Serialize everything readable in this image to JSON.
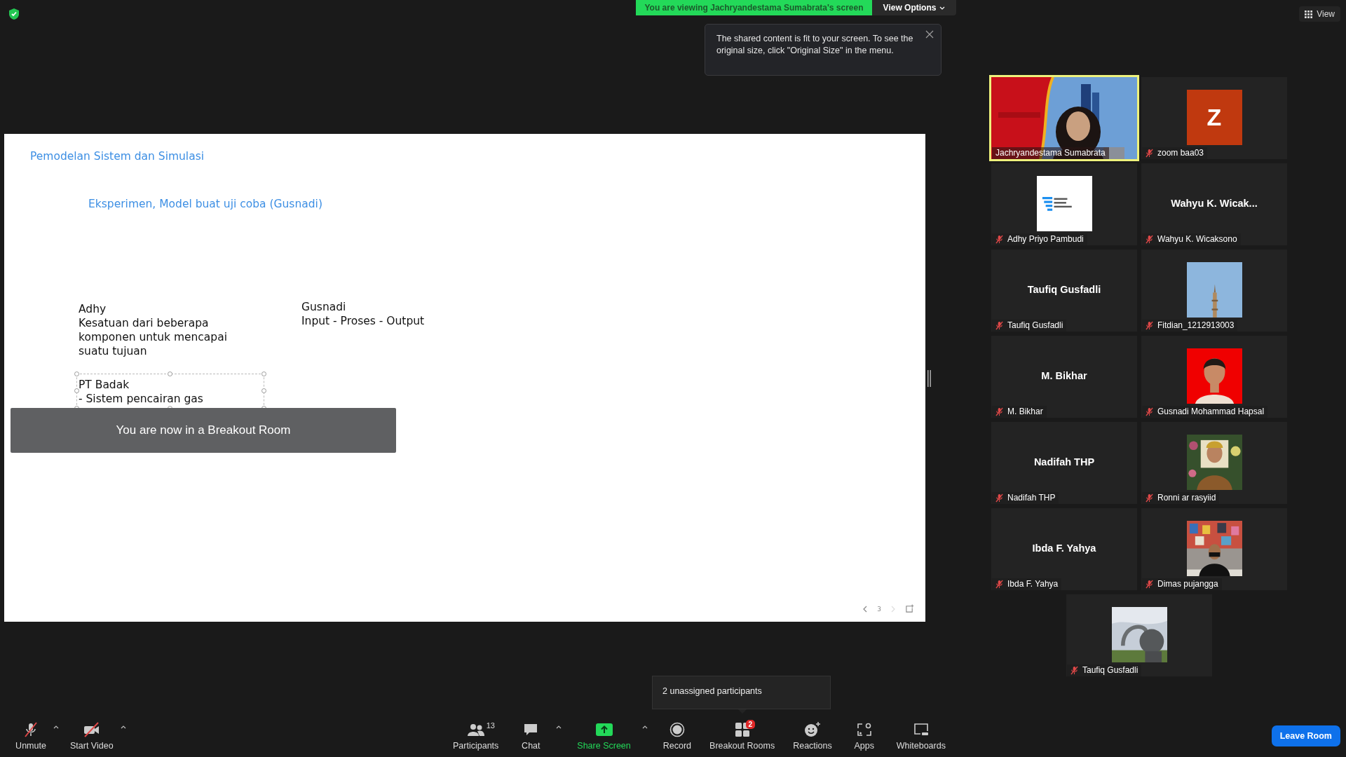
{
  "share_banner": {
    "text": "You are viewing Jachryandestama Sumabrata's screen",
    "view_options": "View Options"
  },
  "tooltip": {
    "text": "The shared content is fit to your screen. To see the original size, click \"Original Size\" in the menu."
  },
  "view_button": "View",
  "slide": {
    "title": "Pemodelan Sistem dan Simulasi",
    "subtitle": "Eksperimen, Model buat uji coba (Gusnadi)",
    "text_boxes": [
      {
        "lines": [
          "Adhy",
          "Kesatuan dari beberapa",
          "komponen untuk mencapai",
          "suatu tujuan"
        ],
        "selected": false
      },
      {
        "lines": [
          "Gusnadi",
          "Input - Proses - Output"
        ],
        "selected": false
      },
      {
        "lines": [
          "PT Badak",
          "- Sistem pencairan gas"
        ],
        "selected": true
      }
    ],
    "page": "3"
  },
  "breakout_notice": "You are now in a Breakout Room",
  "gallery": [
    {
      "name": "Jachryandestama Sumabrata",
      "kind": "video",
      "muted": false,
      "active_speaker": true
    },
    {
      "name": "zoom baa03",
      "kind": "initial",
      "initial": "Z",
      "muted": true,
      "active_speaker": false
    },
    {
      "name": "Adhy Priyo Pambudi",
      "kind": "picture",
      "muted": true,
      "active_speaker": false
    },
    {
      "name": "Wahyu K. Wicaksono",
      "kind": "name",
      "display_name": "Wahyu K. Wicak...",
      "muted": true,
      "active_speaker": false
    },
    {
      "name": "Taufiq Gusfadli",
      "kind": "name",
      "display_name": "Taufiq Gusfadli",
      "muted": true,
      "active_speaker": false
    },
    {
      "name": "Fitdian_1212913003",
      "kind": "picture",
      "muted": true,
      "active_speaker": false
    },
    {
      "name": "M. Bikhar",
      "kind": "name",
      "display_name": "M. Bikhar",
      "muted": true,
      "active_speaker": false
    },
    {
      "name": "Gusnadi Mohammad Hapsal",
      "kind": "picture",
      "muted": true,
      "active_speaker": false
    },
    {
      "name": "Nadifah THP",
      "kind": "name",
      "display_name": "Nadifah THP",
      "muted": true,
      "active_speaker": false
    },
    {
      "name": "Ronni ar rasyiid",
      "kind": "picture",
      "muted": true,
      "active_speaker": false
    },
    {
      "name": "Ibda F. Yahya",
      "kind": "name",
      "display_name": "Ibda F. Yahya",
      "muted": true,
      "active_speaker": false
    },
    {
      "name": "Dimas pujangga",
      "kind": "picture",
      "muted": true,
      "active_speaker": false
    },
    {
      "name": "Taufiq Gusfadli",
      "kind": "picture",
      "muted": true,
      "active_speaker": false
    }
  ],
  "unassigned_popup": "2 unassigned participants",
  "toolbar_left": [
    {
      "kind": "mic",
      "label": "Unmute",
      "off": true,
      "caret": true
    },
    {
      "kind": "video",
      "label": "Start Video",
      "off": true,
      "caret": true
    }
  ],
  "toolbar": [
    {
      "kind": "participants",
      "label": "Participants",
      "count": "13",
      "caret": false
    },
    {
      "kind": "chat",
      "label": "Chat",
      "caret": true
    },
    {
      "kind": "share",
      "label": "Share Screen",
      "caret": true
    },
    {
      "kind": "record",
      "label": "Record",
      "caret": false
    },
    {
      "kind": "breakout",
      "label": "Breakout Rooms",
      "badge": "2",
      "caret": false
    },
    {
      "kind": "reactions",
      "label": "Reactions",
      "caret": false
    },
    {
      "kind": "apps",
      "label": "Apps",
      "caret": false
    },
    {
      "kind": "whiteboards",
      "label": "Whiteboards",
      "caret": false
    }
  ],
  "leave_button": "Leave Room"
}
